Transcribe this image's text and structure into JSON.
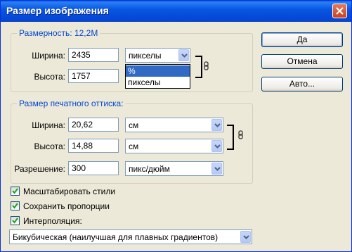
{
  "window": {
    "title": "Размер изображения"
  },
  "pixel_dimensions": {
    "legend": "Размерность:  12,2M",
    "width_label": "Ширина:",
    "width_value": "2435",
    "width_unit": "пикселы",
    "height_label": "Высота:",
    "height_value": "1757",
    "unit_options": [
      "%",
      "пикселы"
    ],
    "highlighted_option": "%"
  },
  "print_size": {
    "legend": "Размер печатного оттиска:",
    "width_label": "Ширина:",
    "width_value": "20,62",
    "width_unit": "см",
    "height_label": "Высота:",
    "height_value": "14,88",
    "height_unit": "см",
    "resolution_label": "Разрешение:",
    "resolution_value": "300",
    "resolution_unit": "пикс/дюйм"
  },
  "buttons": {
    "ok": "Да",
    "cancel": "Отмена",
    "auto": "Авто..."
  },
  "checkboxes": [
    {
      "label": "Масштабировать стили",
      "checked": true
    },
    {
      "label": "Сохранить пропорции",
      "checked": true
    },
    {
      "label": "Интерполяция:",
      "checked": true
    }
  ],
  "interpolation": {
    "value": "Бикубическая (наилучшая для плавных градиентов)"
  }
}
